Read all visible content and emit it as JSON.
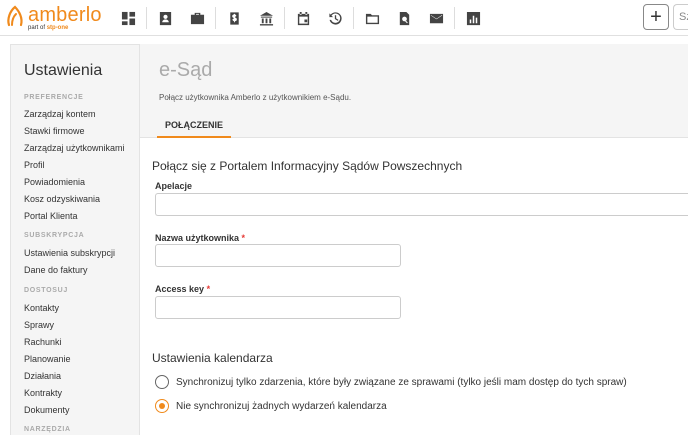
{
  "brand": {
    "name": "amberlo",
    "sub_prefix": "part of",
    "sub_brand": "stp-one",
    "accent_color": "#f08a1c"
  },
  "topbar": {
    "icons": [
      "dashboard-icon",
      "contacts-icon",
      "cases-icon",
      "invoices-icon",
      "court-icon",
      "calendar-icon",
      "history-icon",
      "folder-icon",
      "document-search-icon",
      "mail-icon",
      "reports-icon"
    ],
    "add_label": "+",
    "search_placeholder": "Sz"
  },
  "sidebar": {
    "title": "Ustawienia",
    "sections": [
      {
        "heading": "PREFERENCJE",
        "items": [
          "Zarządzaj kontem",
          "Stawki firmowe",
          "Zarządzaj użytkownikami",
          "Profil",
          "Powiadomienia",
          "Kosz odzyskiwania",
          "Portal Klienta"
        ]
      },
      {
        "heading": "SUBSKRYPCJA",
        "items": [
          "Ustawienia subskrypcji",
          "Dane do faktury"
        ]
      },
      {
        "heading": "DOSTOSUJ",
        "items": [
          "Kontakty",
          "Sprawy",
          "Rachunki",
          "Planowanie",
          "Działania",
          "Kontrakty",
          "Dokumenty"
        ]
      },
      {
        "heading": "NARZĘDZIA",
        "items": []
      }
    ]
  },
  "main": {
    "title": "e-Sąd",
    "description": "Połącz użytkownika Amberlo z użytkownikiem e-Sądu.",
    "tab": "POŁĄCZENIE",
    "connect_section": "Połącz się z Portalem Informacyjny Sądów Powszechnych",
    "fields": {
      "apelacje_label": "Apelacje",
      "apelacje_value": "",
      "username_label": "Nazwa użytkownika",
      "username_value": "",
      "access_key_label": "Access key",
      "access_key_value": "",
      "required_mark": "*"
    },
    "calendar_section": "Ustawienia kalendarza",
    "calendar_options": [
      {
        "label": "Synchronizuj tylko zdarzenia, które były związane ze sprawami (tylko jeśli mam dostęp do tych spraw)",
        "checked": false
      },
      {
        "label": "Nie synchronizuj żadnych wydarzeń kalendarza",
        "checked": true
      }
    ]
  }
}
